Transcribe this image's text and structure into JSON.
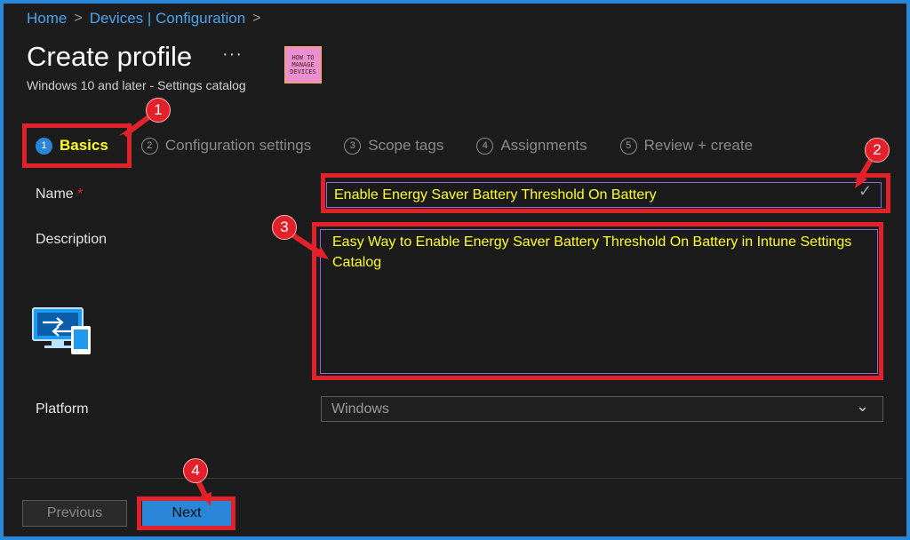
{
  "breadcrumb": {
    "home": "Home",
    "sep1": ">",
    "devices": "Devices | Configuration",
    "sep2": ">"
  },
  "header": {
    "title": "Create profile",
    "more": "···",
    "subtitle": "Windows 10 and later - Settings catalog"
  },
  "logo": {
    "line1": "HOW TO",
    "line2": "MANAGE",
    "line3": "DEVICES"
  },
  "steps": [
    {
      "num": "1",
      "label": "Basics"
    },
    {
      "num": "2",
      "label": "Configuration settings"
    },
    {
      "num": "3",
      "label": "Scope tags"
    },
    {
      "num": "4",
      "label": "Assignments"
    },
    {
      "num": "5",
      "label": "Review + create"
    }
  ],
  "form": {
    "name_label": "Name",
    "required_mark": "*",
    "name_value": "Enable Energy Saver Battery Threshold On Battery",
    "description_label": "Description",
    "description_value": "Easy Way to Enable Energy Saver Battery Threshold On Battery in Intune Settings Catalog",
    "platform_label": "Platform",
    "platform_value": "Windows"
  },
  "annotations": {
    "a1": "1",
    "a2": "2",
    "a3": "3",
    "a4": "4"
  },
  "footer": {
    "previous": "Previous",
    "next": "Next"
  },
  "colors": {
    "accent": "#2a86d8",
    "annotation": "#e3212b",
    "highlight_text": "#ffff2a"
  }
}
